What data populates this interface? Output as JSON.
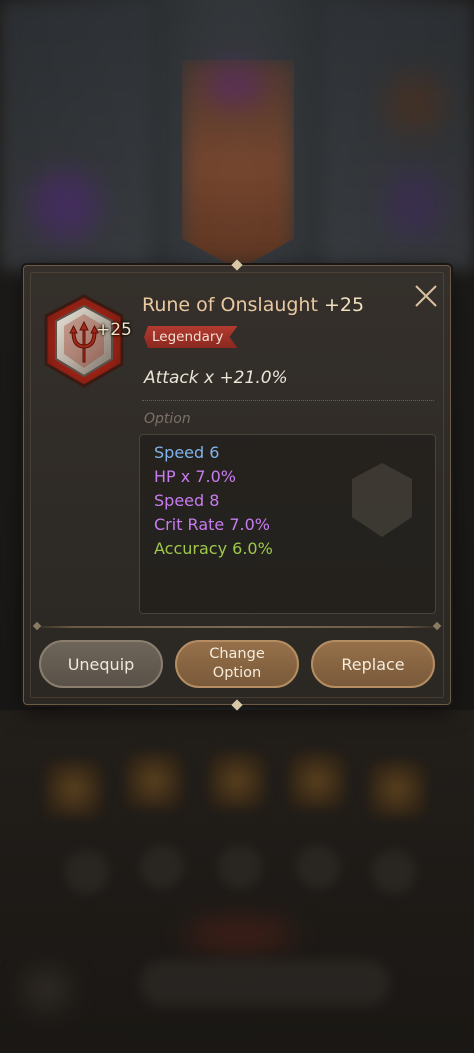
{
  "rune": {
    "level_badge": "+25",
    "name": "Rune of Onslaught",
    "plus": "+25",
    "rarity": "Legendary",
    "main_stat": "Attack x +21.0%",
    "icon": "trident-rune-icon"
  },
  "options": {
    "label": "Option",
    "lines": [
      {
        "text": "Speed 6",
        "color": "#7fb4ea"
      },
      {
        "text": "HP x 7.0%",
        "color": "#c77cf0"
      },
      {
        "text": "Speed 8",
        "color": "#c77cf0"
      },
      {
        "text": "Crit Rate 7.0%",
        "color": "#c77cf0"
      },
      {
        "text": "Accuracy 6.0%",
        "color": "#9ec84a"
      }
    ]
  },
  "buttons": {
    "unequip": "Unequip",
    "change_line1": "Change",
    "change_line2": "Option",
    "replace": "Replace"
  },
  "colors": {
    "title": "#e8c9a0",
    "rarity_bg": "#b23a30",
    "speed_blue": "#7fb4ea",
    "purple": "#c77cf0",
    "green": "#9ec84a"
  }
}
